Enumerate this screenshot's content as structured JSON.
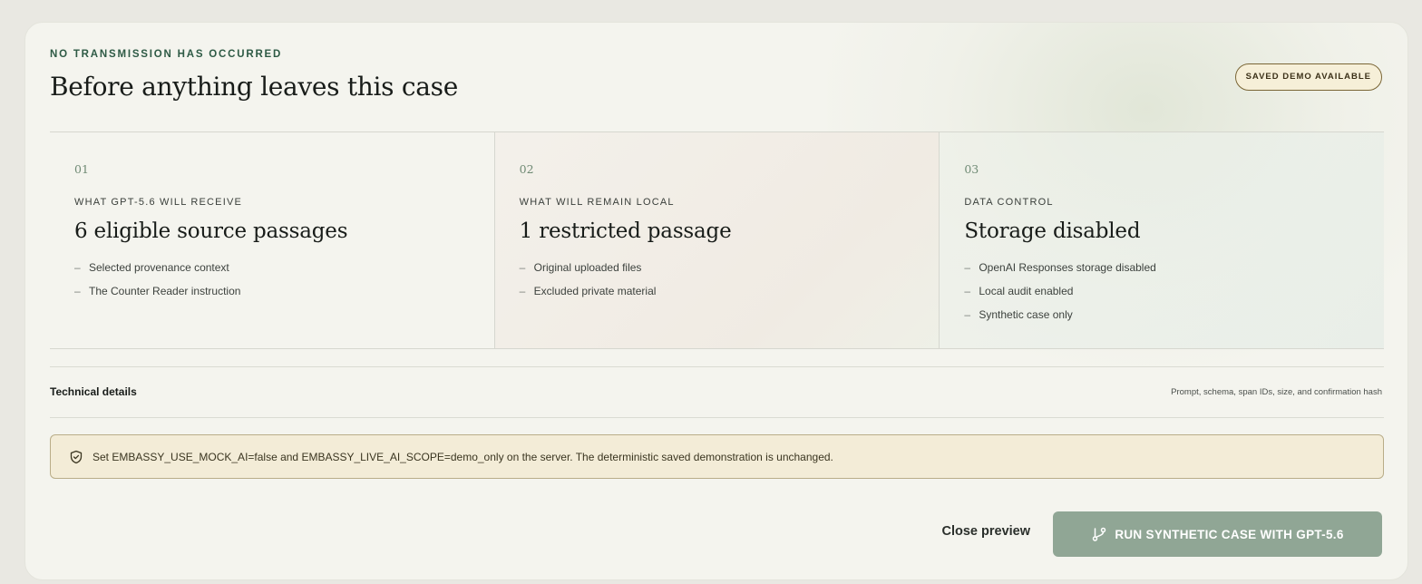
{
  "header": {
    "eyebrow": "NO TRANSMISSION HAS OCCURRED",
    "title": "Before anything leaves this case",
    "badge": "SAVED DEMO AVAILABLE"
  },
  "cards": [
    {
      "num": "01",
      "label": "WHAT GPT-5.6 WILL RECEIVE",
      "heading": "6 eligible source passages",
      "items": [
        "Selected provenance context",
        "The Counter Reader instruction"
      ]
    },
    {
      "num": "02",
      "label": "WHAT WILL REMAIN LOCAL",
      "heading": "1 restricted passage",
      "items": [
        "Original uploaded files",
        "Excluded private material"
      ]
    },
    {
      "num": "03",
      "label": "DATA CONTROL",
      "heading": "Storage disabled",
      "items": [
        "OpenAI Responses storage disabled",
        "Local audit enabled",
        "Synthetic case only"
      ]
    }
  ],
  "list_marker": "–",
  "technical": {
    "title": "Technical details",
    "note": "Prompt, schema, span IDs, size, and confirmation hash"
  },
  "notice": {
    "icon": "shield-check-icon",
    "text": "Set EMBASSY_USE_MOCK_AI=false and EMBASSY_LIVE_AI_SCOPE=demo_only on the server. The deterministic saved demonstration is unchanged."
  },
  "actions": {
    "close_label": "Close preview",
    "run_label": "RUN SYNTHETIC CASE WITH GPT-5.6",
    "run_icon": "git-branch-icon"
  },
  "colors": {
    "accent_green": "#2e5a45",
    "button_fill": "#90a695",
    "notice_bg": "#f3ecd7",
    "badge_bg": "#f6efd8"
  }
}
